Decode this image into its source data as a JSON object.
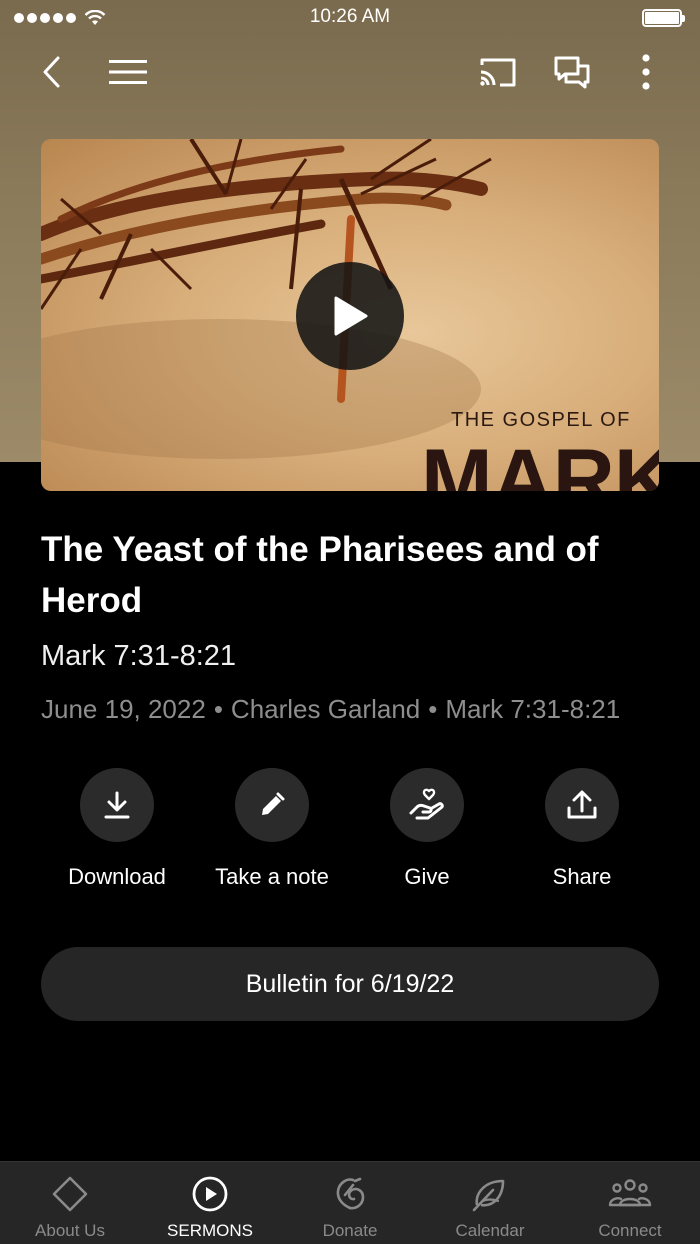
{
  "status_bar": {
    "time": "10:26 AM"
  },
  "hero": {
    "subtitle": "THE GOSPEL OF",
    "title": "MARK"
  },
  "sermon": {
    "title": "The Yeast of the Pharisees and of Herod",
    "scripture": "Mark 7:31-8:21",
    "date": "June 19, 2022",
    "speaker": "Charles Garland",
    "passage": "Mark 7:31-8:21",
    "separator": "•"
  },
  "actions": [
    {
      "label": "Download",
      "icon": "download-icon"
    },
    {
      "label": "Take a note",
      "icon": "pencil-icon"
    },
    {
      "label": "Give",
      "icon": "heart-hand-icon"
    },
    {
      "label": "Share",
      "icon": "share-icon"
    }
  ],
  "bulletin_label": "Bulletin for 6/19/22",
  "tabs": [
    {
      "label": "About Us",
      "icon": "diamond-icon",
      "active": false
    },
    {
      "label": "SERMONS",
      "icon": "play-circle-icon",
      "active": true
    },
    {
      "label": "Donate",
      "icon": "donate-icon",
      "active": false
    },
    {
      "label": "Calendar",
      "icon": "leaf-icon",
      "active": false
    },
    {
      "label": "Connect",
      "icon": "people-icon",
      "active": false
    }
  ],
  "colors": {
    "background": "#000000",
    "header_bg": "#8a7a5a",
    "button_bg": "#2b2b2b",
    "tab_bar_bg": "#262626",
    "meta_text": "#8e8e8e",
    "inactive_tab": "#8a8a8a"
  }
}
